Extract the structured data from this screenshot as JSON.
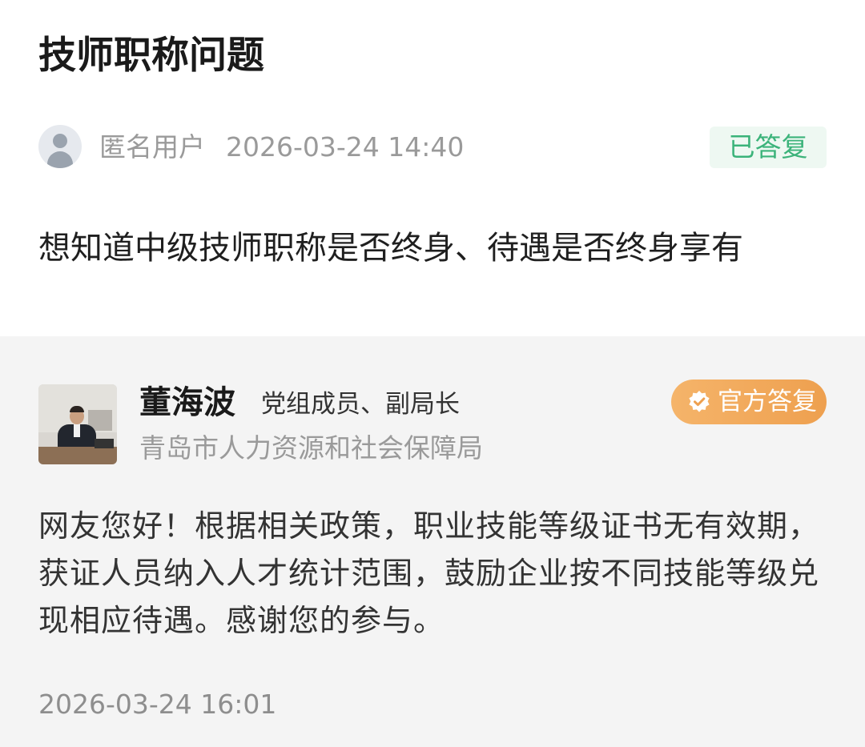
{
  "question": {
    "title": "技师职称问题",
    "asker": {
      "avatar_icon": "default-user-avatar-icon",
      "name": "匿名用户",
      "time": "2026-03-24 14:40"
    },
    "status": "已答复",
    "body": "想知道中级技师职称是否终身、待遇是否终身享有"
  },
  "answer": {
    "responder": {
      "name": "董海波",
      "position": "党组成员、副局长",
      "department": "青岛市人力资源和社会保障局"
    },
    "badge": {
      "icon": "verified-check-icon",
      "label": "官方答复"
    },
    "text": "网友您好！根据相关政策，职业技能等级证书无有效期，获证人员纳入人才统计范围，鼓励企业按不同技能等级兑现相应待遇。感谢您的参与。",
    "time": "2026-03-24 16:01"
  },
  "colors": {
    "status_green": "#3bb37a",
    "official_orange": "#f0a24f",
    "answer_background": "#f4f4f4"
  }
}
